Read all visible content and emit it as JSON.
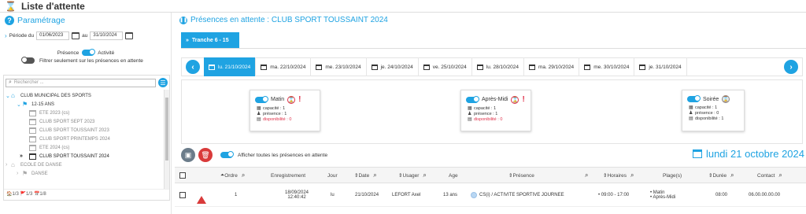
{
  "window": {
    "title": "Liste d'attente"
  },
  "left": {
    "section_title": "Paramétrage",
    "period_label": "Période du",
    "date_from": "01/06/2023",
    "au_label": "au",
    "date_to": "31/10/2024",
    "presence_label": "Présence",
    "activite_label": "Activité",
    "filter_label": "Filtrer seulement sur les présences en attente",
    "search_placeholder": "Rechercher ...",
    "tree": [
      {
        "label": "CLUB MUNICIPAL DES SPORTS",
        "icon": "house-icon"
      },
      {
        "label": "12-15 ANS",
        "icon": "signpost-icon"
      },
      {
        "label": "ETE 2023 (cs)",
        "icon": "calendar-icon"
      },
      {
        "label": "CLUB SPORT SEPT 2023",
        "icon": "calendar-icon"
      },
      {
        "label": "CLUB SPORT TOUSSAINT 2023",
        "icon": "calendar-icon"
      },
      {
        "label": "CLUB SPORT PRINTEMPS 2024",
        "icon": "calendar-icon"
      },
      {
        "label": "ETE 2024 (cs)",
        "icon": "calendar-icon"
      },
      {
        "label": "CLUB SPORT TOUSSAINT 2024",
        "icon": "calendar-icon"
      },
      {
        "label": "ECOLE DE DANSE",
        "icon": "house-icon"
      },
      {
        "label": "DANSE",
        "icon": "signpost-icon"
      }
    ],
    "stats": "🏠1/3 🚩1/3 📅1/8"
  },
  "main": {
    "title": "Présences en attente : CLUB SPORT TOUSSAINT 2024",
    "tranche_label": "Tranche 6 - 15",
    "days": [
      "lu. 21/10/2024",
      "ma. 22/10/2024",
      "me. 23/10/2024",
      "je. 24/10/2024",
      "ve. 25/10/2024",
      "lu. 28/10/2024",
      "ma. 29/10/2024",
      "me. 30/10/2024",
      "je. 31/10/2024"
    ],
    "active_day_index": 0,
    "slots": [
      {
        "name": "Matin",
        "capacite": "capacité : 1",
        "presence": "présence : 1",
        "disponibilite": "disponibilité : 0",
        "warning": true
      },
      {
        "name": "Après-Midi",
        "capacite": "capacité : 1",
        "presence": "présence : 1",
        "disponibilite": "disponibilité : 0",
        "warning": true
      },
      {
        "name": "Soirée",
        "capacite": "capacité : 1",
        "presence": "présence : 0",
        "disponibilite": "disponibilité : 1",
        "warning": false
      }
    ],
    "show_all_label": "Afficher toutes les présences en attente",
    "big_date": "lundi 21 octobre 2024",
    "columns": {
      "ordre": "Ordre",
      "enregistrement": "Enregistrement",
      "jour": "Jour",
      "date": "Date",
      "usager": "Usager",
      "age": "Age",
      "presence": "Présence",
      "horaires": "Horaires",
      "plages": "Plage(s)",
      "duree": "Durée",
      "contact": "Contact"
    },
    "rows": [
      {
        "ordre": "1",
        "enreg_date": "18/09/2024",
        "enreg_time": "12:40:42",
        "jour": "lu",
        "date": "21/10/2024",
        "usager": "LEFORT Axel",
        "age": "13 ans",
        "presence": "CS(i) / ACTIVITE SPORTIVE JOURNEE",
        "horaires": "09:00 - 17:00",
        "plage1": "Matin",
        "plage2": "Après-Midi",
        "duree": "08:00",
        "contact": "06.00.00.00.00"
      }
    ]
  },
  "colors": {
    "accent": "#1fa3e2",
    "danger": "#d93a3a"
  }
}
